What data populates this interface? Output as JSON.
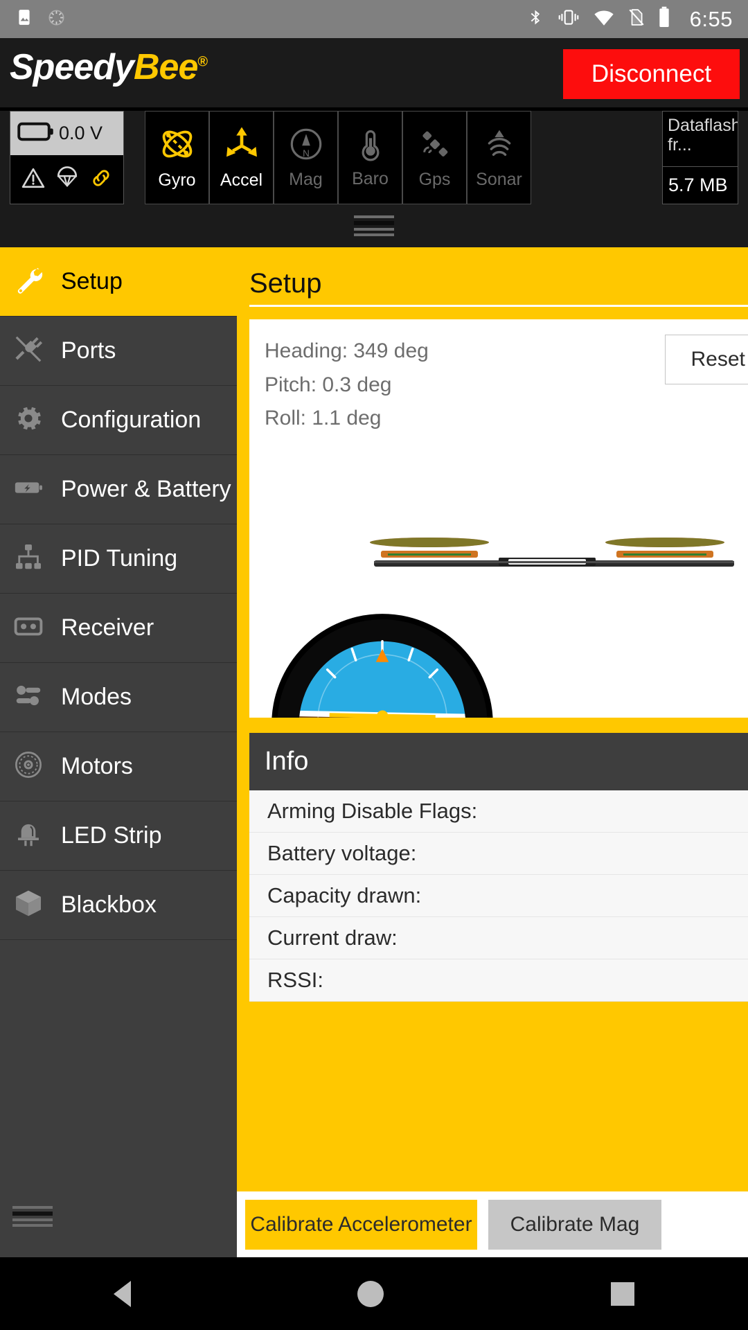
{
  "statusbar": {
    "icons": [
      "image-icon",
      "sync-spinner-icon",
      "bluetooth-icon",
      "vibrate-icon",
      "wifi-icon",
      "sim-off-icon",
      "battery-icon"
    ],
    "time": "6:55"
  },
  "header": {
    "brand_first": "Speedy",
    "brand_second": "Bee",
    "brand_reg": "®",
    "disconnect_label": "Disconnect",
    "disconnect_color": "#fd0d0d"
  },
  "sensorbar": {
    "battery": {
      "voltage": "0.0 V",
      "icons": [
        "warning-icon",
        "parachute-icon",
        "link-icon"
      ]
    },
    "sensors": [
      {
        "label": "Gyro",
        "icon": "gyro-icon",
        "active": true
      },
      {
        "label": "Accel",
        "icon": "accel-icon",
        "active": true
      },
      {
        "label": "Mag",
        "icon": "compass-icon",
        "active": false
      },
      {
        "label": "Baro",
        "icon": "thermometer-icon",
        "active": false
      },
      {
        "label": "Gps",
        "icon": "satellite-icon",
        "active": false
      },
      {
        "label": "Sonar",
        "icon": "sonar-icon",
        "active": false
      }
    ],
    "dataflash": {
      "label": "Dataflash fr...",
      "value": "5.7 MB"
    }
  },
  "sidebar": {
    "items": [
      {
        "label": "Setup",
        "icon": "wrench-icon",
        "active": true
      },
      {
        "label": "Ports",
        "icon": "plug-icon",
        "active": false
      },
      {
        "label": "Configuration",
        "icon": "gear-icon",
        "active": false
      },
      {
        "label": "Power & Battery",
        "icon": "battery-icon",
        "active": false
      },
      {
        "label": "PID Tuning",
        "icon": "hierarchy-icon",
        "active": false
      },
      {
        "label": "Receiver",
        "icon": "radio-icon",
        "active": false
      },
      {
        "label": "Modes",
        "icon": "sliders-icon",
        "active": false
      },
      {
        "label": "Motors",
        "icon": "propeller-icon",
        "active": false
      },
      {
        "label": "LED Strip",
        "icon": "led-icon",
        "active": false
      },
      {
        "label": "Blackbox",
        "icon": "box-icon",
        "active": false
      }
    ]
  },
  "main": {
    "title": "Setup",
    "attitude": {
      "heading": "Heading: 349 deg",
      "pitch": "Pitch: 0.3 deg",
      "roll": "Roll: 1.1 deg"
    },
    "reset_button": "Reset Z",
    "info": {
      "title": "Info",
      "rows": [
        {
          "label": "Arming Disable Flags:",
          "value": ""
        },
        {
          "label": "Battery voltage:",
          "value": ""
        },
        {
          "label": "Capacity drawn:",
          "value": ""
        },
        {
          "label": "Current draw:",
          "value": ""
        },
        {
          "label": "RSSI:",
          "value": ""
        }
      ]
    },
    "buttons": {
      "calibrate_accel": "Calibrate Accelerometer",
      "calibrate_mag": "Calibrate Mag"
    }
  },
  "navbar": {
    "back": "back-icon",
    "home": "home-icon",
    "recent": "recent-apps-icon"
  },
  "colors": {
    "accent": "#ffc800",
    "danger": "#fd0d0d",
    "sidebar": "#3e3e3e",
    "appbar": "#1b1b1b"
  }
}
